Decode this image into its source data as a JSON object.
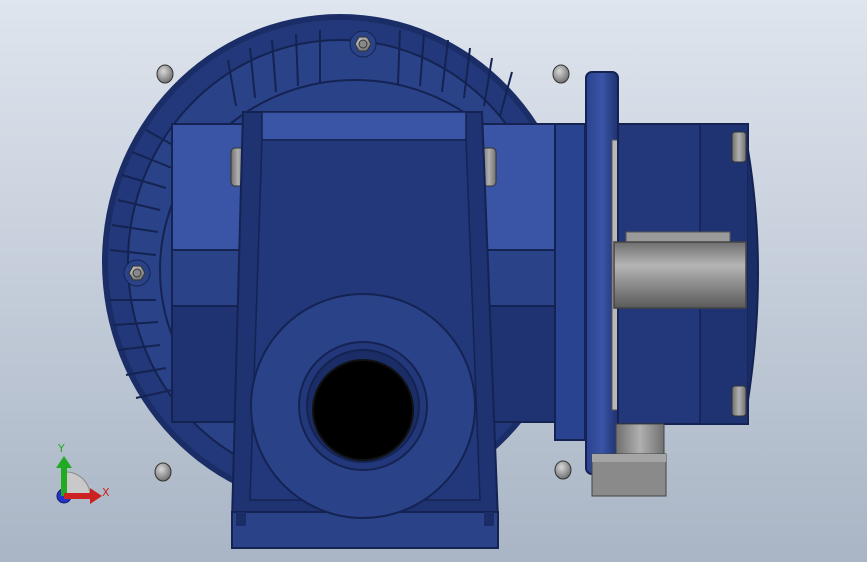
{
  "viewport": {
    "background_top": "#dfe5ee",
    "background_bottom": "#a9b5c5"
  },
  "model": {
    "body_color": "#23387a",
    "body_highlight": "#3a55a6",
    "body_shadow": "#152552",
    "steel_color": "#8a8a8a",
    "bore_color": "#000000"
  },
  "triad": {
    "x_label": "X",
    "y_label": "Y",
    "x_color": "#cc2222",
    "y_color": "#22aa22",
    "z_color": "#2233cc"
  }
}
